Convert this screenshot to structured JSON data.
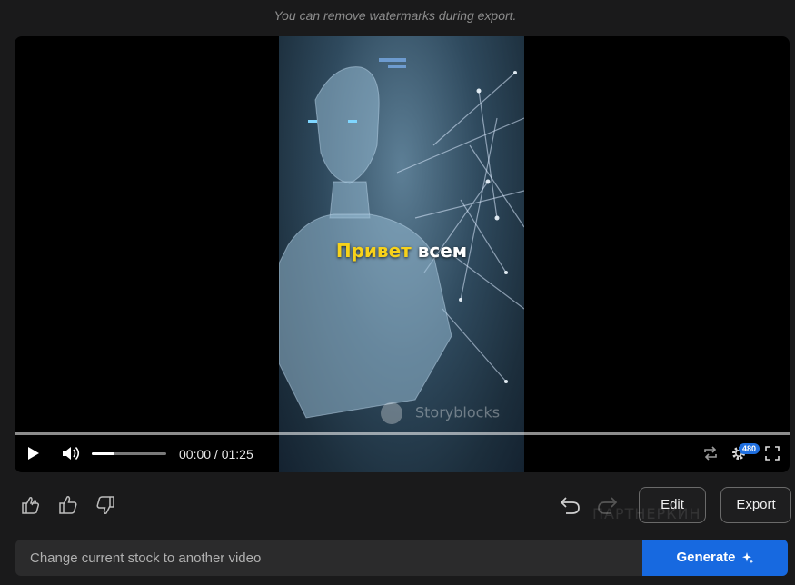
{
  "notice": "You can remove watermarks during export.",
  "video": {
    "caption_highlight": "Привет",
    "caption_rest": "всем",
    "stock_watermark": "Storyblocks"
  },
  "player": {
    "progress": 0.0,
    "volume_level": 0.3,
    "time": "00:00 / 01:25",
    "quality": "480",
    "icons": [
      "play-icon",
      "volume-icon",
      "loop-icon",
      "gear-icon",
      "fullscreen-icon"
    ]
  },
  "feedback": {
    "icons": [
      "super-like-icon",
      "thumbs-up-icon",
      "thumbs-down-icon",
      "undo-icon",
      "redo-icon"
    ]
  },
  "buttons": {
    "edit": "Edit",
    "export": "Export"
  },
  "watermark_partner": "ПАРТНЕРКИН",
  "prompt": {
    "placeholder": "Change current stock to another video",
    "generate": "Generate"
  },
  "colors": {
    "accent": "#1769e0",
    "caption_highlight": "#f7d21a",
    "background": "#1a1a1b"
  }
}
